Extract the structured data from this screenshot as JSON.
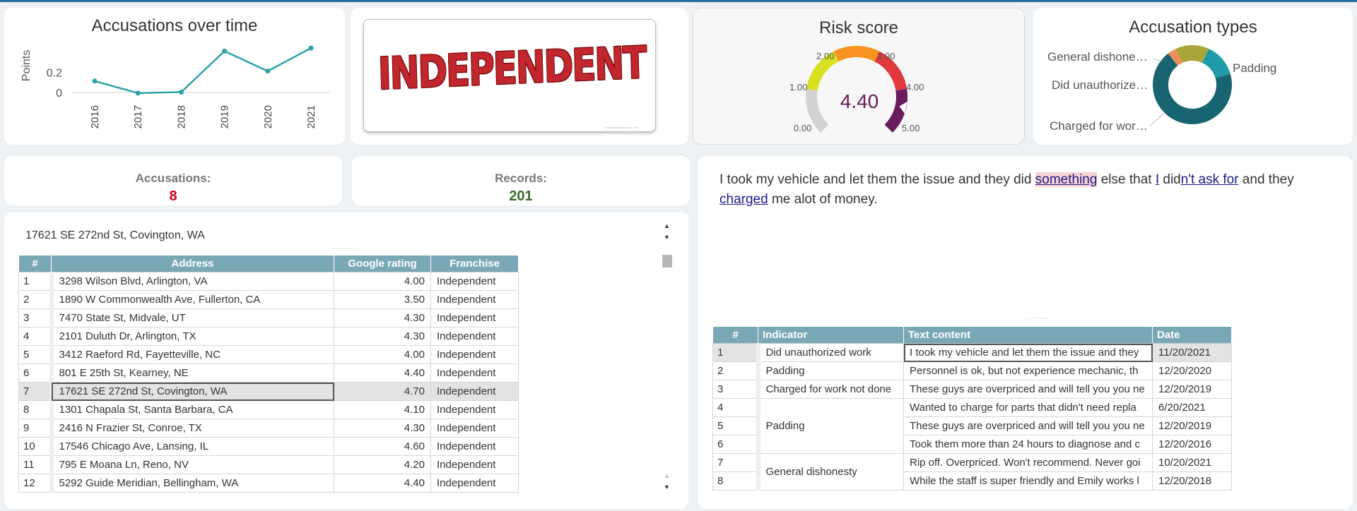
{
  "line_chart": {
    "title": "Accusations over time",
    "ylabel": "Points",
    "yticks": [
      "0.2",
      "0"
    ],
    "chart_data": {
      "type": "line",
      "x": [
        "2016",
        "2017",
        "2018",
        "2019",
        "2020",
        "2021"
      ],
      "values": [
        0.12,
        0.0,
        0.01,
        0.42,
        0.22,
        0.45
      ],
      "title": "Accusations over time",
      "ylabel": "Points",
      "ylim": [
        -0.05,
        0.5
      ],
      "color": "#2ba3a8"
    }
  },
  "logo": {
    "text": "INDEPENDENT",
    "color": "#c1272d"
  },
  "gauge": {
    "title": "Risk score",
    "value_text": "4.40",
    "value": 4.4,
    "min": 0,
    "max": 5,
    "ticks": [
      "0.00",
      "1.00",
      "2.00",
      "3.00",
      "4.00",
      "5.00"
    ],
    "band_colors": [
      "#d3d3d3",
      "#d9e021",
      "#f7931e",
      "#e03a3e",
      "#6b1a5e"
    ]
  },
  "pie": {
    "title": "Accusation types",
    "labels": [
      "General dishone…",
      "Did unauthorize…",
      "Charged for wor…",
      "Padding"
    ],
    "chart_data": {
      "type": "pie",
      "title": "Accusation types",
      "categories": [
        "General dishonesty",
        "Did unauthorized work",
        "Charged for work not done",
        "Padding"
      ],
      "values": [
        0.25,
        1,
        1,
        5
      ],
      "colors": [
        "#f28b5b",
        "#a9a53a",
        "#1e9aa8",
        "#186470"
      ]
    }
  },
  "kpis": {
    "accusations_label": "Accusations:",
    "accusations_value": "8",
    "accusations_color": "#d0021b",
    "records_label": "Records:",
    "records_value": "201",
    "records_color": "#3a6b2a"
  },
  "address_table": {
    "selected_address": "17621 SE 272nd St, Covington, WA",
    "headers": [
      "#",
      "Address",
      "Google rating",
      "Franchise"
    ],
    "rows": [
      [
        "1",
        "3298 Wilson Blvd, Arlington, VA",
        "4.00",
        "Independent"
      ],
      [
        "2",
        "1890 W Commonwealth Ave, Fullerton, CA",
        "3.50",
        "Independent"
      ],
      [
        "3",
        "7470 State St, Midvale, UT",
        "4.30",
        "Independent"
      ],
      [
        "4",
        "2101 Duluth Dr, Arlington, TX",
        "4.30",
        "Independent"
      ],
      [
        "5",
        "3412 Raeford Rd, Fayetteville, NC",
        "4.00",
        "Independent"
      ],
      [
        "6",
        "801 E 25th St, Kearney, NE",
        "4.40",
        "Independent"
      ],
      [
        "7",
        "17621 SE 272nd St, Covington, WA",
        "4.70",
        "Independent"
      ],
      [
        "8",
        "1301 Chapala St, Santa Barbara, CA",
        "4.10",
        "Independent"
      ],
      [
        "9",
        "2416 N Frazier St, Conroe, TX",
        "4.30",
        "Independent"
      ],
      [
        "10",
        "17546 Chicago Ave, Lansing, IL",
        "4.60",
        "Independent"
      ],
      [
        "11",
        "795 E Moana Ln, Reno, NV",
        "4.20",
        "Independent"
      ],
      [
        "12",
        "5292 Guide Meridian, Bellingham, WA",
        "4.40",
        "Independent"
      ]
    ]
  },
  "review": {
    "segments": [
      {
        "t": "I took my vehicle and let them the issue and they did ",
        "s": ""
      },
      {
        "t": "something",
        "s": "hl-pink"
      },
      {
        "t": " else that ",
        "s": ""
      },
      {
        "t": "I",
        "s": "hl-blue"
      },
      {
        "t": " did",
        "s": ""
      },
      {
        "t": "n't ask for",
        "s": "hl-blue"
      },
      {
        "t": " and they ",
        "s": ""
      },
      {
        "t": "charged",
        "s": "hl-blue"
      },
      {
        "t": " me alot of money.",
        "s": ""
      }
    ]
  },
  "indicator_table": {
    "headers": [
      "#",
      "Indicator",
      "Text content",
      "Date"
    ],
    "rows": [
      [
        "1",
        "Did unauthorized work",
        "I took my vehicle and let them the issue and they",
        "11/20/2021"
      ],
      [
        "2",
        "Padding",
        "Personnel is ok, but not experience mechanic, th",
        "12/20/2020"
      ],
      [
        "3",
        "Charged for work not done",
        "These guys are overpriced and will tell you you ne",
        "12/20/2019"
      ],
      [
        "4",
        "Padding",
        "Wanted to charge for parts that didn't need repla",
        "6/20/2021"
      ],
      [
        "5",
        "",
        "These guys are overpriced and will tell you you ne",
        "12/20/2019"
      ],
      [
        "6",
        "",
        "Took them more than 24 hours to diagnose and c",
        "12/20/2016"
      ],
      [
        "7",
        "General dishonesty",
        "Rip off. Overpriced. Won't recommend. Never goi",
        "10/20/2021"
      ],
      [
        "8",
        "",
        "While the staff is super friendly and Emily works l",
        "12/20/2018"
      ]
    ]
  }
}
